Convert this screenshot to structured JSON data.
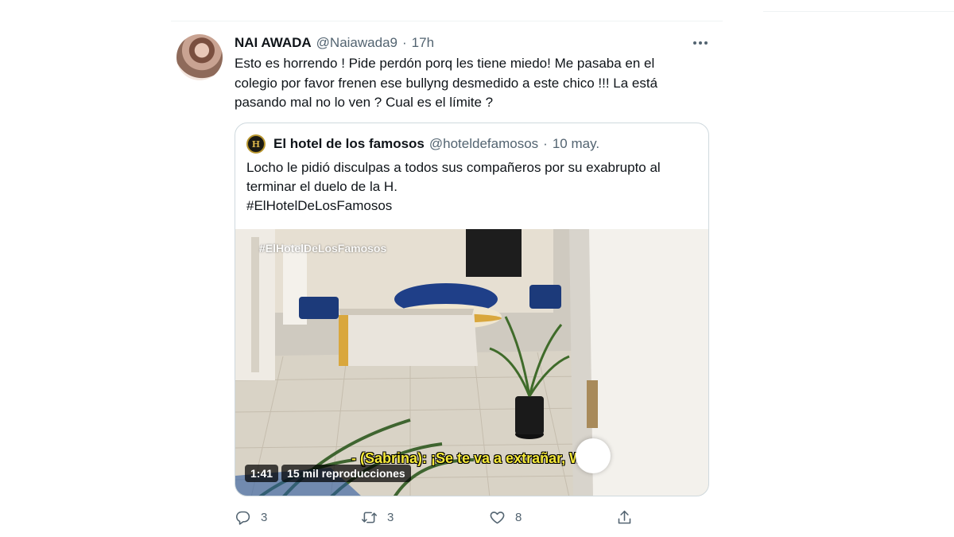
{
  "tweet": {
    "display_name": "NAI AWADA",
    "handle": "@Naiawada9",
    "separator": "·",
    "time": "17h",
    "text_lines": [
      "Esto es horrendo ! Pide perdón porq les tiene miedo! Me pasaba en el",
      "colegio por favor frenen ese bullyng desmedido a este chico !!! La está",
      "pasando mal no lo ven ? Cual es el límite ?"
    ],
    "actions": {
      "reply_count": "3",
      "retweet_count": "3",
      "like_count": "8"
    }
  },
  "quoted_tweet": {
    "avatar_letter": "H",
    "display_name": "El hotel de los famosos",
    "handle": "@hoteldefamosos",
    "separator": "·",
    "time": "10 may.",
    "text_lines": [
      "Locho le pidió disculpas a todos sus compañeros por su exabrupto al",
      "terminar el duelo de la H.",
      "#ElHotelDeLosFamosos"
    ],
    "video": {
      "watermark": "#ElHotelDeLosFamosos",
      "subtitle": "- (Sabrina): ¡Se te va a extrañar, Wal!",
      "duration": "1:41",
      "views": "15 mil reproducciones"
    }
  },
  "icons": {
    "more": "more-horizontal-icon",
    "reply": "reply-icon",
    "retweet": "retweet-icon",
    "like": "heart-icon",
    "share": "share-icon"
  },
  "colors": {
    "text_primary": "#0f1419",
    "text_secondary": "#536471",
    "border": "#cfd9de",
    "subtitle_yellow": "#f6ea3a"
  }
}
